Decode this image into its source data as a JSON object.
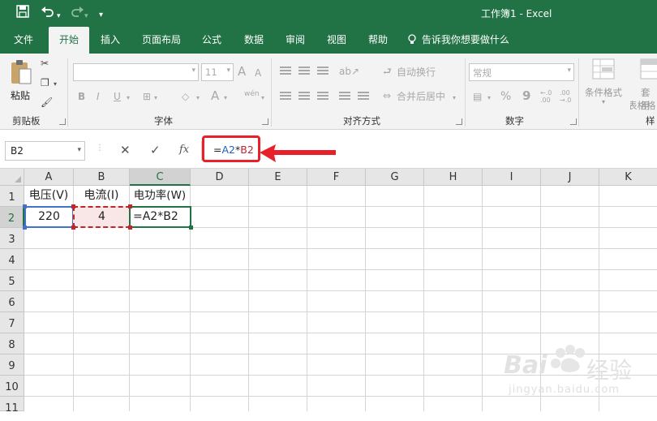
{
  "titlebar": {
    "title": "工作簿1 - Excel",
    "icons": [
      "save-icon",
      "undo-icon",
      "redo-icon",
      "customize-qat-icon"
    ]
  },
  "tabs": [
    "文件",
    "开始",
    "插入",
    "页面布局",
    "公式",
    "数据",
    "审阅",
    "视图",
    "帮助"
  ],
  "active_tab": "开始",
  "tell_me": "告诉我你想要做什么",
  "ribbon": {
    "clipboard": {
      "paste_label": "粘贴",
      "group_label": "剪贴板"
    },
    "font": {
      "font_size": "11",
      "bold": "B",
      "italic": "I",
      "underline": "U",
      "grow": "A",
      "shrink": "A",
      "phonetic": "wén",
      "group_label": "字体"
    },
    "alignment": {
      "wrap_text": "自动换行",
      "merge_center": "合并后居中",
      "group_label": "对齐方式"
    },
    "number": {
      "format": "常规",
      "percent": "%",
      "comma": "9",
      "group_label": "数字"
    },
    "styles": {
      "conditional": "条件格式",
      "table_format_1": "套用",
      "table_format_2": "表格格",
      "group_label": "样"
    }
  },
  "formula_bar": {
    "name_box": "B2",
    "fx": "fx",
    "formula_parts": [
      {
        "text": "=",
        "color": "#222222"
      },
      {
        "text": "A2",
        "color": "#1f5fc4"
      },
      {
        "text": "*",
        "color": "#222222"
      },
      {
        "text": "B2",
        "color": "#c0262d"
      }
    ]
  },
  "sheet": {
    "columns": [
      "A",
      "B",
      "C",
      "D",
      "E",
      "F",
      "G",
      "H",
      "I",
      "J",
      "K"
    ],
    "rows": [
      "1",
      "2",
      "3",
      "4",
      "5",
      "6",
      "7",
      "8",
      "9",
      "10",
      "11"
    ],
    "selected_column": "C",
    "selected_row": "2",
    "cells": {
      "A1": "电压(V)",
      "B1": "电流(I)",
      "C1": "电功率(W)",
      "A2": "220",
      "B2": "4",
      "C2": "=A2*B2"
    }
  },
  "colors": {
    "excel_green": "#217346",
    "ref_blue": "#1f5fc4",
    "ref_red": "#c0262d",
    "callout_red": "#e8202a"
  },
  "watermark": {
    "logo_text": "Bai",
    "logo_text_2": "经验",
    "url": "jingyan.baidu.com"
  }
}
